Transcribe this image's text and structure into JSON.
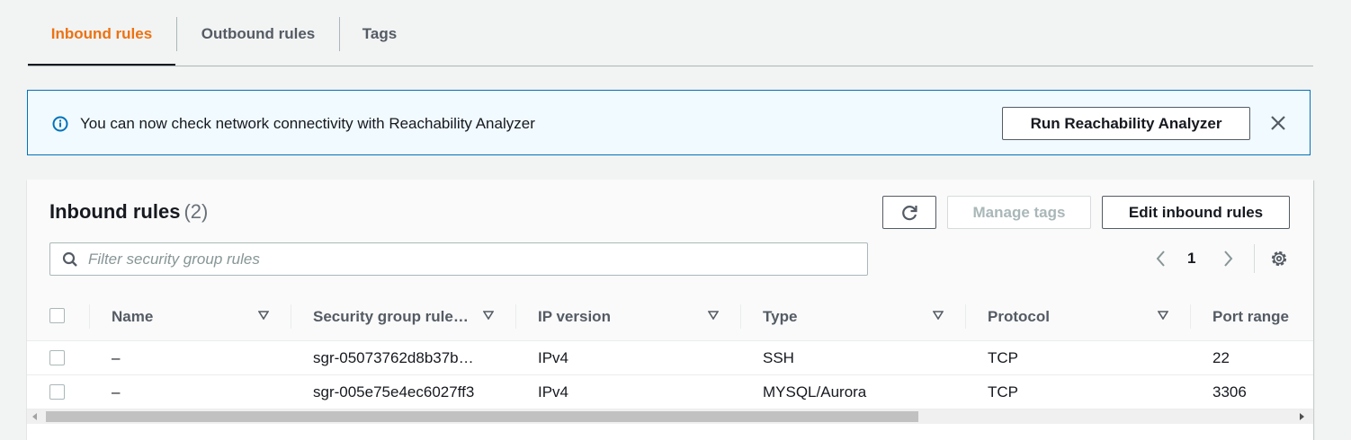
{
  "tabs": [
    {
      "label": "Inbound rules",
      "active": true
    },
    {
      "label": "Outbound rules",
      "active": false
    },
    {
      "label": "Tags",
      "active": false
    }
  ],
  "flash": {
    "message": "You can now check network connectivity with Reachability Analyzer",
    "button_label": "Run Reachability Analyzer"
  },
  "panel": {
    "title": "Inbound rules",
    "count": "(2)",
    "manage_tags_label": "Manage tags",
    "edit_label": "Edit inbound rules",
    "filter_placeholder": "Filter security group rules",
    "page": "1"
  },
  "table": {
    "columns": [
      "Name",
      "Security group rule…",
      "IP version",
      "Type",
      "Protocol",
      "Port range"
    ],
    "rows": [
      [
        "–",
        "sgr-05073762d8b37b…",
        "IPv4",
        "SSH",
        "TCP",
        "22"
      ],
      [
        "–",
        "sgr-005e75e4ec6027ff3",
        "IPv4",
        "MYSQL/Aurora",
        "TCP",
        "3306"
      ]
    ]
  },
  "colors": {
    "accent_orange": "#ec7211",
    "info_blue": "#0073bb",
    "flash_bg": "#f1faff",
    "text": "#16191f",
    "muted": "#545b64"
  }
}
